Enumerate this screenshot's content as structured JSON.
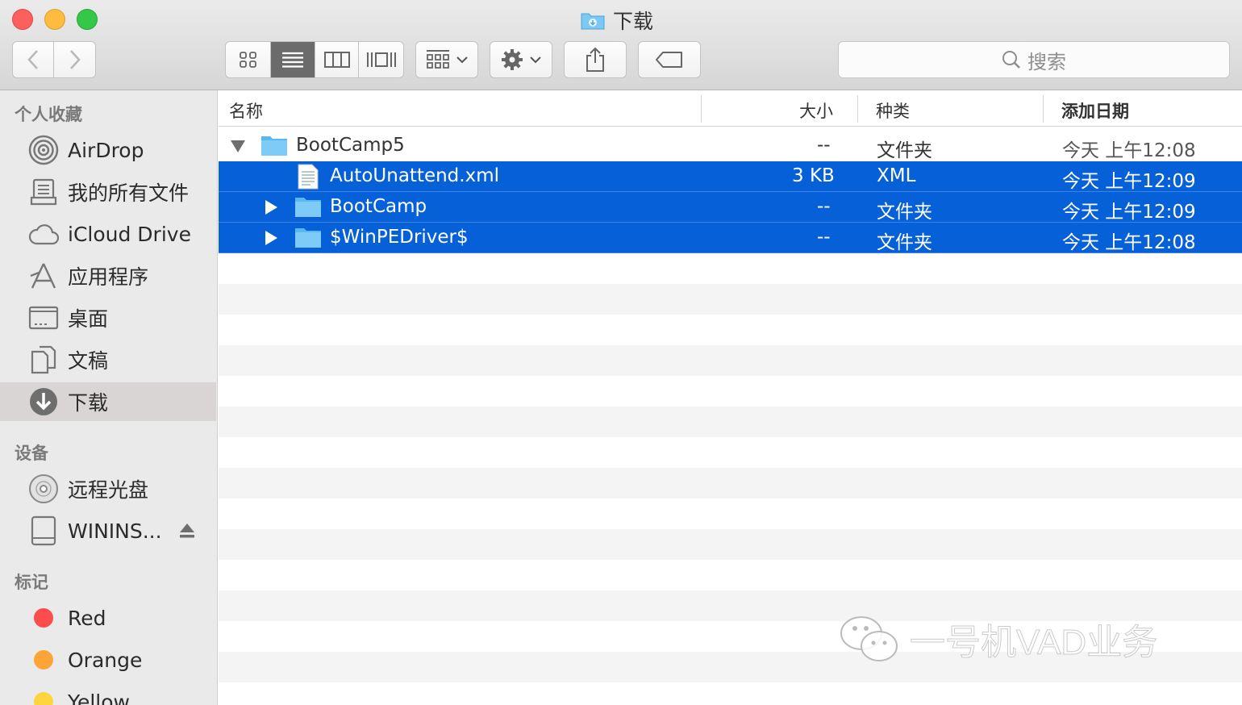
{
  "window": {
    "title": "下载"
  },
  "toolbar": {
    "search_placeholder": "搜索",
    "icons": [
      "back-icon",
      "forward-icon",
      "icon-view-icon",
      "list-view-icon",
      "column-view-icon",
      "coverflow-view-icon",
      "arrange-icon",
      "gear-icon",
      "share-icon",
      "tag-icon"
    ]
  },
  "sidebar": {
    "favorites_title": "个人收藏",
    "favorites": [
      {
        "label": "AirDrop",
        "icon": "airdrop-icon"
      },
      {
        "label": "我的所有文件",
        "icon": "all-files-icon"
      },
      {
        "label": "iCloud Drive",
        "icon": "cloud-icon"
      },
      {
        "label": "应用程序",
        "icon": "applications-icon"
      },
      {
        "label": "桌面",
        "icon": "desktop-icon"
      },
      {
        "label": "文稿",
        "icon": "documents-icon"
      },
      {
        "label": "下载",
        "icon": "downloads-icon",
        "selected": true
      }
    ],
    "devices_title": "设备",
    "devices": [
      {
        "label": "远程光盘",
        "icon": "disc-icon"
      },
      {
        "label": "WININS...",
        "icon": "drive-icon"
      }
    ],
    "tags_title": "标记",
    "tags": [
      {
        "label": "Red",
        "color": "#fc4d4d"
      },
      {
        "label": "Orange",
        "color": "#fda439"
      },
      {
        "label": "Yellow",
        "color": "#fed53c"
      }
    ]
  },
  "columns": {
    "name": "名称",
    "size": "大小",
    "kind": "种类",
    "date_added": "添加日期"
  },
  "files": [
    {
      "name": "BootCamp5",
      "size": "--",
      "kind": "文件夹",
      "date": "今天 上午12:08",
      "type": "folder",
      "level": 0,
      "expanded": true,
      "selected": false
    },
    {
      "name": "AutoUnattend.xml",
      "size": "3 KB",
      "kind": "XML",
      "date": "今天 上午12:09",
      "type": "file",
      "level": 1,
      "selected": true
    },
    {
      "name": "BootCamp",
      "size": "--",
      "kind": "文件夹",
      "date": "今天 上午12:09",
      "type": "folder",
      "level": 1,
      "expanded": false,
      "selected": true
    },
    {
      "name": "$WinPEDriver$",
      "size": "--",
      "kind": "文件夹",
      "date": "今天 上午12:08",
      "type": "folder",
      "level": 1,
      "expanded": false,
      "selected": true
    }
  ],
  "watermark": {
    "text": "一号机VAD业务"
  },
  "colors": {
    "selection": "#0660d8",
    "folder": "#5ab8f0"
  }
}
